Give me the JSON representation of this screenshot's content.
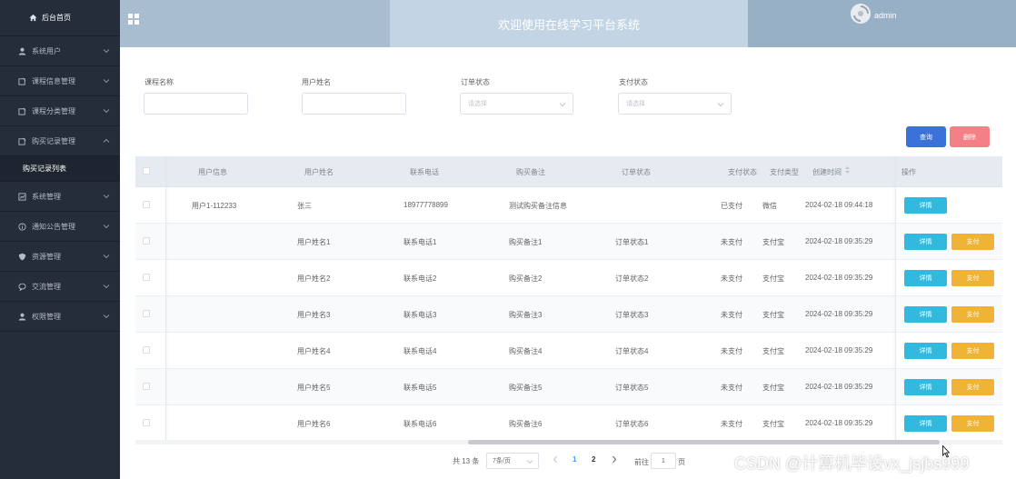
{
  "sidebar": {
    "home": "后台首页",
    "items": [
      {
        "label": "系统用户",
        "icon": "user-icon",
        "chevron": "down"
      },
      {
        "label": "课程信息管理",
        "icon": "edit-icon",
        "chevron": "down"
      },
      {
        "label": "课程分类管理",
        "icon": "edit-icon",
        "chevron": "down"
      },
      {
        "label": "购买记录管理",
        "icon": "edit-icon",
        "chevron": "up"
      }
    ],
    "active_sub": "购买记录列表",
    "items_after": [
      {
        "label": "系统管理",
        "icon": "chart-icon",
        "chevron": "down"
      },
      {
        "label": "通知公告管理",
        "icon": "info-icon",
        "chevron": "down"
      },
      {
        "label": "资源管理",
        "icon": "shield-icon",
        "chevron": "down"
      },
      {
        "label": "交流管理",
        "icon": "chat-icon",
        "chevron": "down"
      },
      {
        "label": "权限管理",
        "icon": "user-icon",
        "chevron": "down"
      }
    ]
  },
  "header": {
    "title": "欢迎使用在线学习平台系统",
    "username": "admin"
  },
  "filters": {
    "course_name_label": "课程名称",
    "user_name_label": "用户姓名",
    "order_status_label": "订单状态",
    "order_status_placeholder": "请选择",
    "pay_status_label": "支付状态",
    "pay_status_placeholder": "请选择",
    "query_button": "查询",
    "delete_button": "删除"
  },
  "table": {
    "headers": {
      "user_info": "用户信息",
      "user_name": "用户姓名",
      "phone": "联系电话",
      "note": "购买备注",
      "order_status": "订单状态",
      "pay_status": "支付状态",
      "pay_type": "支付类型",
      "created": "创建时间",
      "actions": "操作"
    },
    "detail_label": "详情",
    "pay_label": "支付",
    "rows": [
      {
        "user_info": "用户1-112233",
        "user_name": "张三",
        "phone": "18977778899",
        "note": "测试购买备注信息",
        "order_status": "",
        "pay_status": "已支付",
        "pay_type": "微信",
        "created": "2024-02-18 09:44:18",
        "show_pay": false
      },
      {
        "user_info": "",
        "user_name": "用户姓名1",
        "phone": "联系电话1",
        "note": "购买备注1",
        "order_status": "订单状态1",
        "pay_status": "未支付",
        "pay_type": "支付宝",
        "created": "2024-02-18 09:35:29",
        "show_pay": true
      },
      {
        "user_info": "",
        "user_name": "用户姓名2",
        "phone": "联系电话2",
        "note": "购买备注2",
        "order_status": "订单状态2",
        "pay_status": "未支付",
        "pay_type": "支付宝",
        "created": "2024-02-18 09:35:29",
        "show_pay": true
      },
      {
        "user_info": "",
        "user_name": "用户姓名3",
        "phone": "联系电话3",
        "note": "购买备注3",
        "order_status": "订单状态3",
        "pay_status": "未支付",
        "pay_type": "支付宝",
        "created": "2024-02-18 09:35:29",
        "show_pay": true
      },
      {
        "user_info": "",
        "user_name": "用户姓名4",
        "phone": "联系电话4",
        "note": "购买备注4",
        "order_status": "订单状态4",
        "pay_status": "未支付",
        "pay_type": "支付宝",
        "created": "2024-02-18 09:35:29",
        "show_pay": true
      },
      {
        "user_info": "",
        "user_name": "用户姓名5",
        "phone": "联系电话5",
        "note": "购买备注5",
        "order_status": "订单状态5",
        "pay_status": "未支付",
        "pay_type": "支付宝",
        "created": "2024-02-18 09:35:29",
        "show_pay": true
      },
      {
        "user_info": "",
        "user_name": "用户姓名6",
        "phone": "联系电话6",
        "note": "购买备注6",
        "order_status": "订单状态6",
        "pay_status": "未支付",
        "pay_type": "支付宝",
        "created": "2024-02-18 09:35:29",
        "show_pay": true
      }
    ]
  },
  "pagination": {
    "total": "共 13 条",
    "page_size": "7条/页",
    "page1": "1",
    "page2": "2",
    "goto_label": "前往",
    "goto_value": "1",
    "page_unit": "页"
  },
  "watermark": "CSDN @计算机毕设vx_jsjbs999",
  "colors": {
    "sidebar_bg": "#252c3a",
    "header_bg": "#a8bdd0",
    "query_btn": "#3b72d9",
    "delete_btn": "#f57f86",
    "detail_btn": "#33b9df",
    "pay_btn": "#f0b337",
    "active_page": "#409eff"
  }
}
